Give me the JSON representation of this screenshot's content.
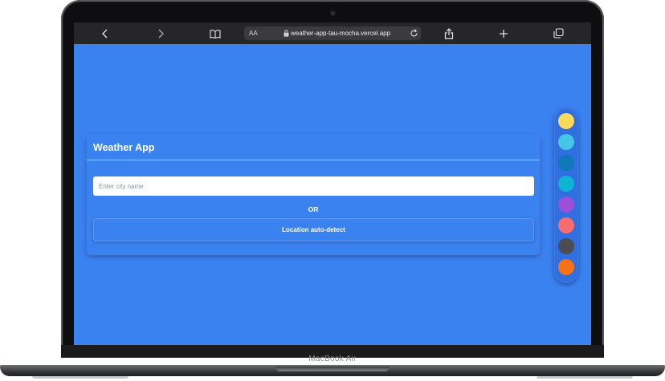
{
  "browser": {
    "text_size_label": "AA",
    "url": "weather-app-tau-mocha.vercel.app"
  },
  "app": {
    "title": "Weather App",
    "city_input_placeholder": "Enter city name",
    "city_input_value": "",
    "or_label": "OR",
    "locate_button_label": "Location auto-detect"
  },
  "theme_palette": {
    "colors": [
      "#fbd95b",
      "#45c6e6",
      "#0f78b8",
      "#0db4d4",
      "#9c4fd8",
      "#f76c6c",
      "#4b4d53",
      "#f97316"
    ]
  },
  "device": {
    "model_label": "MacBook Air"
  }
}
